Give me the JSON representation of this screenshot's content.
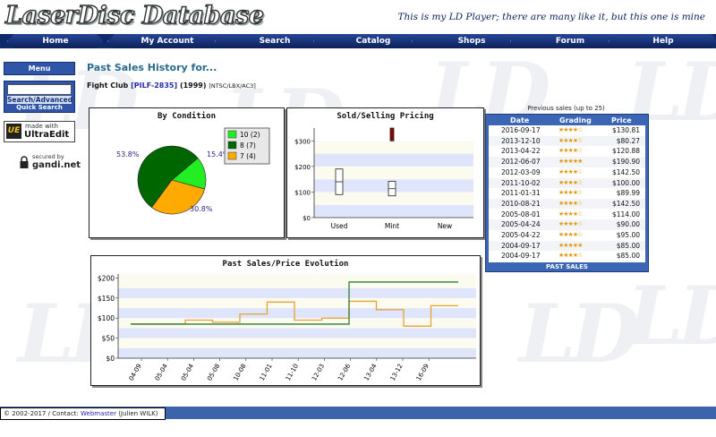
{
  "site": {
    "logo": "LaserDisc Database",
    "tagline": "This is my LD Player; there are many like it, but this one is mine"
  },
  "nav": [
    "Home",
    "My Account",
    "Search",
    "Catalog",
    "Shops",
    "Forum",
    "Help"
  ],
  "sidebar": {
    "menu": "Menu",
    "search_input": "",
    "search_advanced": "Search/Advanced",
    "quick_search": "Quick Search",
    "ultraedit_made": "made with",
    "ultraedit_name": "UltraEdit",
    "gandi_secured": "secured by",
    "gandi_name": "gandi.net"
  },
  "page": {
    "title": "Past Sales History for...",
    "movie_title": "Fight Club",
    "catalog": "[PILF-2835]",
    "year": "(1999)",
    "format": "[NTSC/LBX/AC3]"
  },
  "chart_data": [
    {
      "type": "pie",
      "title": "By Condition",
      "slices": [
        {
          "label": "10",
          "count": 2,
          "percent": 15.4,
          "color": "#22ee22"
        },
        {
          "label": "8",
          "count": 7,
          "percent": 53.8,
          "color": "#006600"
        },
        {
          "label": "7",
          "count": 4,
          "percent": 30.8,
          "color": "#ffaa00"
        }
      ],
      "legend": [
        "10 (2)",
        "8 (7)",
        "7 (4)"
      ],
      "pct_labels": [
        "15.4%",
        "53.8%",
        "30.8%"
      ]
    },
    {
      "type": "box",
      "title": "Sold/Selling Pricing",
      "categories": [
        "Used",
        "Mint",
        "New"
      ],
      "yticks": [
        "$0",
        "$100",
        "$200",
        "$300"
      ],
      "ylim": [
        0,
        350
      ],
      "boxes": [
        {
          "category": "Used",
          "low": 90,
          "high": 190,
          "mid": 140,
          "color": "#ffffff"
        },
        {
          "category": "Mint",
          "low": 85,
          "high": 142,
          "mid": 113,
          "color": "#ffffff"
        },
        {
          "category": "Mint",
          "low": 300,
          "high": 350,
          "mid": 325,
          "color": "#8b0000"
        }
      ]
    },
    {
      "type": "line",
      "title": "Past Sales/Price Evolution",
      "xlabels": [
        "04-09",
        "05-04",
        "05-04",
        "05-08",
        "10-08",
        "11-01",
        "11-10",
        "12-03",
        "12-06",
        "13-04",
        "13-12",
        "16-09"
      ],
      "yticks": [
        "$0",
        "$50",
        "$100",
        "$150",
        "$200"
      ],
      "ylim": [
        0,
        210
      ],
      "series": [
        {
          "color": "#e8a030",
          "values": [
            85,
            85,
            95,
            90,
            110,
            140,
            95,
            100,
            142,
            121,
            80,
            131
          ]
        },
        {
          "color": "#2e7d32",
          "values": [
            85,
            85,
            85,
            85,
            85,
            85,
            85,
            85,
            190,
            190,
            190,
            190
          ]
        }
      ]
    }
  ],
  "previous_sales": {
    "caption": "Previous sales (up to 25)",
    "headers": [
      "Date",
      "Grading",
      "Price"
    ],
    "rows": [
      {
        "date": "2016-09-17",
        "stars": 4,
        "price": "$130.81"
      },
      {
        "date": "2013-12-10",
        "stars": 4,
        "price": "$80.27"
      },
      {
        "date": "2013-04-22",
        "stars": 4,
        "price": "$120.88"
      },
      {
        "date": "2012-06-07",
        "stars": 5,
        "price": "$190.90"
      },
      {
        "date": "2012-03-09",
        "stars": 4,
        "price": "$142.50"
      },
      {
        "date": "2011-10-02",
        "stars": 4,
        "price": "$100.00"
      },
      {
        "date": "2011-01-31",
        "stars": 4,
        "price": "$89.99"
      },
      {
        "date": "2010-08-21",
        "stars": 4,
        "price": "$142.50"
      },
      {
        "date": "2005-08-01",
        "stars": 4,
        "price": "$114.00"
      },
      {
        "date": "2005-04-24",
        "stars": 4,
        "price": "$90.00"
      },
      {
        "date": "2005-04-22",
        "stars": 4,
        "price": "$95.00"
      },
      {
        "date": "2004-09-17",
        "stars": 5,
        "price": "$85.00"
      },
      {
        "date": "2004-09-17",
        "stars": 4,
        "price": "$85.00"
      }
    ],
    "footer": "PAST SALES"
  },
  "footer": {
    "copyright": "© 2002-2017 / Contact:",
    "webmaster": "Webmaster",
    "name": "(Julien WILK)"
  }
}
